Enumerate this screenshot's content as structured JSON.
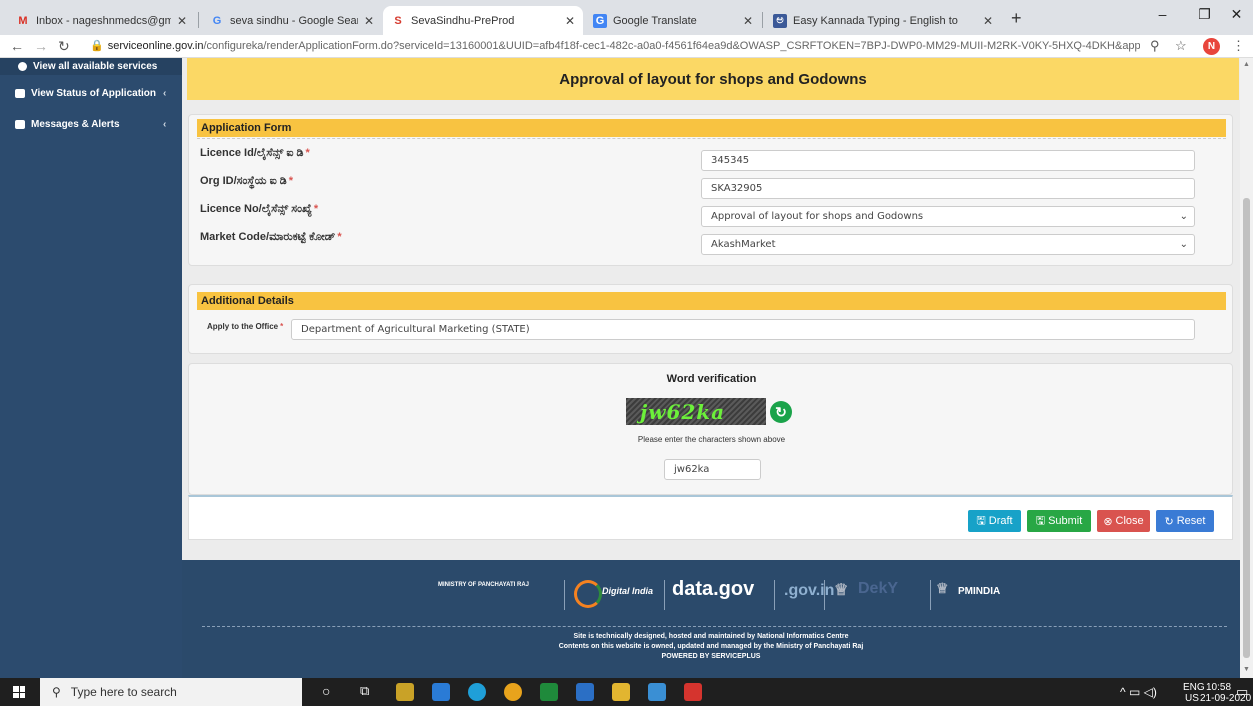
{
  "browser": {
    "tabs": [
      {
        "label": "Inbox - nageshnmedcs@gmail.co",
        "icon": "gmail-icon",
        "active": false
      },
      {
        "label": "seva sindhu - Google Search",
        "icon": "google-icon",
        "active": false
      },
      {
        "label": "SevaSindhu-PreProd",
        "icon": "sevasindhu-icon",
        "active": true
      },
      {
        "label": "Google Translate",
        "icon": "translate-icon",
        "active": false
      },
      {
        "label": "Easy Kannada Typing - English to",
        "icon": "kannada-icon",
        "active": false
      }
    ],
    "url_domain": "serviceonline.gov.in",
    "url_path": "/configureka/renderApplicationForm.do?serviceId=13160001&UUID=afb4f18f-cec1-482c-a0a0-f4561f64ea9d&OWASP_CSRFTOKEN=7BPJ-DWP0-MM29-MUII-M2RK-V0KY-5HXQ-4DKH&appl...",
    "profile_initial": "N"
  },
  "sidebar": {
    "top_item": "View all available services",
    "items": [
      {
        "label": "View Status of Application"
      },
      {
        "label": "Messages & Alerts"
      }
    ]
  },
  "page": {
    "title": "Approval of layout for shops and Godowns"
  },
  "application_form": {
    "heading": "Application Form",
    "fields": [
      {
        "label": "Licence Id/ಲೈಸೆನ್ಸ್ ಐ ಡಿ",
        "value": "345345",
        "type": "text"
      },
      {
        "label": "Org ID/ಸಂಸ್ಥೆಯ ಐ ಡಿ",
        "value": "SKA32905",
        "type": "text"
      },
      {
        "label": "Licence No/ಲೈಸೆನ್ಸ್ ಸಂಖ್ಯೆ",
        "value": "Approval of layout for shops and Godowns",
        "type": "select"
      },
      {
        "label": "Market Code/ಮಾರುಕಟ್ಟೆ ಕೋಡ್",
        "value": "AkashMarket",
        "type": "select"
      }
    ]
  },
  "additional_details": {
    "heading": "Additional Details",
    "office_label": "Apply to the Office",
    "office_value": "Department of Agricultural Marketing (STATE)"
  },
  "verification": {
    "heading": "Word verification",
    "captcha_text": "jw62ka",
    "instruction": "Please enter the characters shown above",
    "input_value": "jw62ka"
  },
  "actions": {
    "draft": "Draft",
    "submit": "Submit",
    "close": "Close",
    "reset": "Reset"
  },
  "footer": {
    "logos": [
      "MINISTRY OF PANCHAYATI RAJ",
      "Digital India",
      "data.gov",
      ".gov.in",
      "PMINDIA"
    ],
    "line1": "Site is technically designed, hosted and maintained by National Informatics Centre",
    "line2": "Contents on this website is owned, updated and managed by the Ministry of Panchayati Raj",
    "line3": "POWERED BY SERVICEPLUS"
  },
  "taskbar": {
    "search_placeholder": "Type here to search",
    "lang": "ENG",
    "region": "US",
    "time": "10:58",
    "date": "21-09-2020"
  },
  "colors": {
    "sidebar": "#2c4b6e",
    "title_bar": "#fbd865",
    "section_header": "#f8c341",
    "draft": "#17a2c8",
    "submit": "#28a745",
    "close": "#d9534f",
    "reset": "#3a7bd5"
  }
}
